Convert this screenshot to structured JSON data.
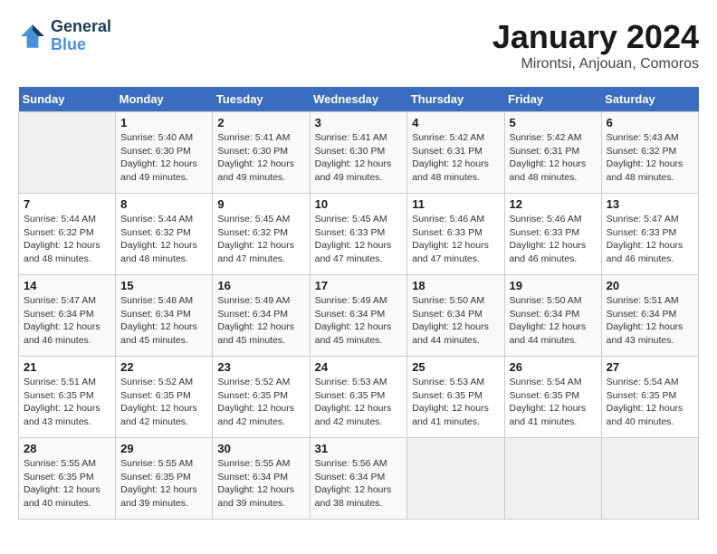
{
  "header": {
    "logo_line1": "General",
    "logo_line2": "Blue",
    "month": "January 2024",
    "location": "Mirontsi, Anjouan, Comoros"
  },
  "weekdays": [
    "Sunday",
    "Monday",
    "Tuesday",
    "Wednesday",
    "Thursday",
    "Friday",
    "Saturday"
  ],
  "weeks": [
    [
      {
        "day": "",
        "info": ""
      },
      {
        "day": "1",
        "info": "Sunrise: 5:40 AM\nSunset: 6:30 PM\nDaylight: 12 hours\nand 49 minutes."
      },
      {
        "day": "2",
        "info": "Sunrise: 5:41 AM\nSunset: 6:30 PM\nDaylight: 12 hours\nand 49 minutes."
      },
      {
        "day": "3",
        "info": "Sunrise: 5:41 AM\nSunset: 6:30 PM\nDaylight: 12 hours\nand 49 minutes."
      },
      {
        "day": "4",
        "info": "Sunrise: 5:42 AM\nSunset: 6:31 PM\nDaylight: 12 hours\nand 48 minutes."
      },
      {
        "day": "5",
        "info": "Sunrise: 5:42 AM\nSunset: 6:31 PM\nDaylight: 12 hours\nand 48 minutes."
      },
      {
        "day": "6",
        "info": "Sunrise: 5:43 AM\nSunset: 6:32 PM\nDaylight: 12 hours\nand 48 minutes."
      }
    ],
    [
      {
        "day": "7",
        "info": "Sunrise: 5:44 AM\nSunset: 6:32 PM\nDaylight: 12 hours\nand 48 minutes."
      },
      {
        "day": "8",
        "info": "Sunrise: 5:44 AM\nSunset: 6:32 PM\nDaylight: 12 hours\nand 48 minutes."
      },
      {
        "day": "9",
        "info": "Sunrise: 5:45 AM\nSunset: 6:32 PM\nDaylight: 12 hours\nand 47 minutes."
      },
      {
        "day": "10",
        "info": "Sunrise: 5:45 AM\nSunset: 6:33 PM\nDaylight: 12 hours\nand 47 minutes."
      },
      {
        "day": "11",
        "info": "Sunrise: 5:46 AM\nSunset: 6:33 PM\nDaylight: 12 hours\nand 47 minutes."
      },
      {
        "day": "12",
        "info": "Sunrise: 5:46 AM\nSunset: 6:33 PM\nDaylight: 12 hours\nand 46 minutes."
      },
      {
        "day": "13",
        "info": "Sunrise: 5:47 AM\nSunset: 6:33 PM\nDaylight: 12 hours\nand 46 minutes."
      }
    ],
    [
      {
        "day": "14",
        "info": "Sunrise: 5:47 AM\nSunset: 6:34 PM\nDaylight: 12 hours\nand 46 minutes."
      },
      {
        "day": "15",
        "info": "Sunrise: 5:48 AM\nSunset: 6:34 PM\nDaylight: 12 hours\nand 45 minutes."
      },
      {
        "day": "16",
        "info": "Sunrise: 5:49 AM\nSunset: 6:34 PM\nDaylight: 12 hours\nand 45 minutes."
      },
      {
        "day": "17",
        "info": "Sunrise: 5:49 AM\nSunset: 6:34 PM\nDaylight: 12 hours\nand 45 minutes."
      },
      {
        "day": "18",
        "info": "Sunrise: 5:50 AM\nSunset: 6:34 PM\nDaylight: 12 hours\nand 44 minutes."
      },
      {
        "day": "19",
        "info": "Sunrise: 5:50 AM\nSunset: 6:34 PM\nDaylight: 12 hours\nand 44 minutes."
      },
      {
        "day": "20",
        "info": "Sunrise: 5:51 AM\nSunset: 6:34 PM\nDaylight: 12 hours\nand 43 minutes."
      }
    ],
    [
      {
        "day": "21",
        "info": "Sunrise: 5:51 AM\nSunset: 6:35 PM\nDaylight: 12 hours\nand 43 minutes."
      },
      {
        "day": "22",
        "info": "Sunrise: 5:52 AM\nSunset: 6:35 PM\nDaylight: 12 hours\nand 42 minutes."
      },
      {
        "day": "23",
        "info": "Sunrise: 5:52 AM\nSunset: 6:35 PM\nDaylight: 12 hours\nand 42 minutes."
      },
      {
        "day": "24",
        "info": "Sunrise: 5:53 AM\nSunset: 6:35 PM\nDaylight: 12 hours\nand 42 minutes."
      },
      {
        "day": "25",
        "info": "Sunrise: 5:53 AM\nSunset: 6:35 PM\nDaylight: 12 hours\nand 41 minutes."
      },
      {
        "day": "26",
        "info": "Sunrise: 5:54 AM\nSunset: 6:35 PM\nDaylight: 12 hours\nand 41 minutes."
      },
      {
        "day": "27",
        "info": "Sunrise: 5:54 AM\nSunset: 6:35 PM\nDaylight: 12 hours\nand 40 minutes."
      }
    ],
    [
      {
        "day": "28",
        "info": "Sunrise: 5:55 AM\nSunset: 6:35 PM\nDaylight: 12 hours\nand 40 minutes."
      },
      {
        "day": "29",
        "info": "Sunrise: 5:55 AM\nSunset: 6:35 PM\nDaylight: 12 hours\nand 39 minutes."
      },
      {
        "day": "30",
        "info": "Sunrise: 5:55 AM\nSunset: 6:34 PM\nDaylight: 12 hours\nand 39 minutes."
      },
      {
        "day": "31",
        "info": "Sunrise: 5:56 AM\nSunset: 6:34 PM\nDaylight: 12 hours\nand 38 minutes."
      },
      {
        "day": "",
        "info": ""
      },
      {
        "day": "",
        "info": ""
      },
      {
        "day": "",
        "info": ""
      }
    ]
  ]
}
